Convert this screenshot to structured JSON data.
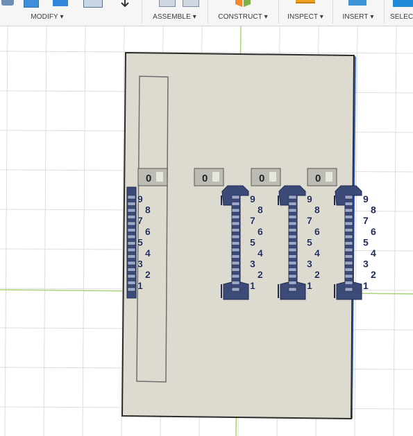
{
  "toolbar": {
    "groups": [
      {
        "label": "MODIFY ▾",
        "icons": [
          "push-pull-icon",
          "fillet-icon",
          "shell-icon",
          "combine-icon",
          "move-icon"
        ]
      },
      {
        "label": "ASSEMBLE ▾",
        "icons": [
          "new-component-icon",
          "joint-icon"
        ]
      },
      {
        "label": "CONSTRUCT ▾",
        "icons": [
          "offset-plane-icon"
        ]
      },
      {
        "label": "INSPECT ▾",
        "icons": [
          "measure-icon"
        ]
      },
      {
        "label": "INSERT ▾",
        "icons": [
          "insert-image-icon"
        ]
      },
      {
        "label": "SELECT",
        "icons": [
          "select-icon"
        ]
      }
    ]
  },
  "model": {
    "window_labels": [
      "0",
      "0",
      "0",
      "0"
    ],
    "scale_digits": [
      "9",
      "8",
      "7",
      "6",
      "5",
      "4",
      "3",
      "2",
      "1"
    ]
  },
  "colors": {
    "plate": "#dddbd0",
    "slider": "#3c4a78",
    "grid": "#dcdcdc",
    "axis": "#a9d37a",
    "selection_edge": "#3b6fe0"
  }
}
